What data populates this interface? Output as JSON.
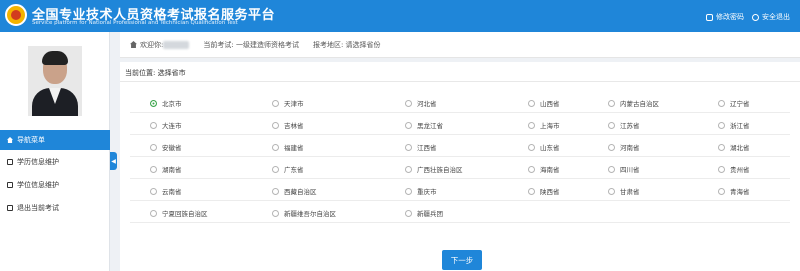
{
  "header": {
    "title": "全国专业技术人员资格考试报名服务平台",
    "subtitle": "Service platform for National Professional and Technician Qualification Test",
    "change_password": "修改密码",
    "logout": "安全退出"
  },
  "sidebar": {
    "items": [
      {
        "label": "导航菜单",
        "icon": "home-icon"
      },
      {
        "label": "学历信息维护",
        "icon": "user-icon"
      },
      {
        "label": "学位信息维护",
        "icon": "user-icon"
      },
      {
        "label": "退出当前考试",
        "icon": "exit-icon"
      }
    ]
  },
  "infobar": {
    "welcome": "欢迎你:",
    "current_exam": "当前考试: 一级建造师资格考试",
    "exam_region": "报考地区: 请选择省份"
  },
  "crumb": "当前位置: 选择省市",
  "provinces": [
    [
      "北京市",
      "天津市",
      "河北省",
      "山西省",
      "内蒙古自治区",
      "辽宁省"
    ],
    [
      "大连市",
      "吉林省",
      "黑龙江省",
      "上海市",
      "江苏省",
      "浙江省"
    ],
    [
      "安徽省",
      "福建省",
      "江西省",
      "山东省",
      "河南省",
      "湖北省"
    ],
    [
      "湖南省",
      "广东省",
      "广西壮族自治区",
      "海南省",
      "四川省",
      "贵州省"
    ],
    [
      "云南省",
      "西藏自治区",
      "重庆市",
      "陕西省",
      "甘肃省",
      "青海省"
    ],
    [
      "宁夏回族自治区",
      "新疆维吾尔自治区",
      "新疆兵团"
    ]
  ],
  "selected": "北京市",
  "next_label": "下一步",
  "colors": {
    "primary": "#1f86d9",
    "selected_radio": "#3ba54b"
  }
}
